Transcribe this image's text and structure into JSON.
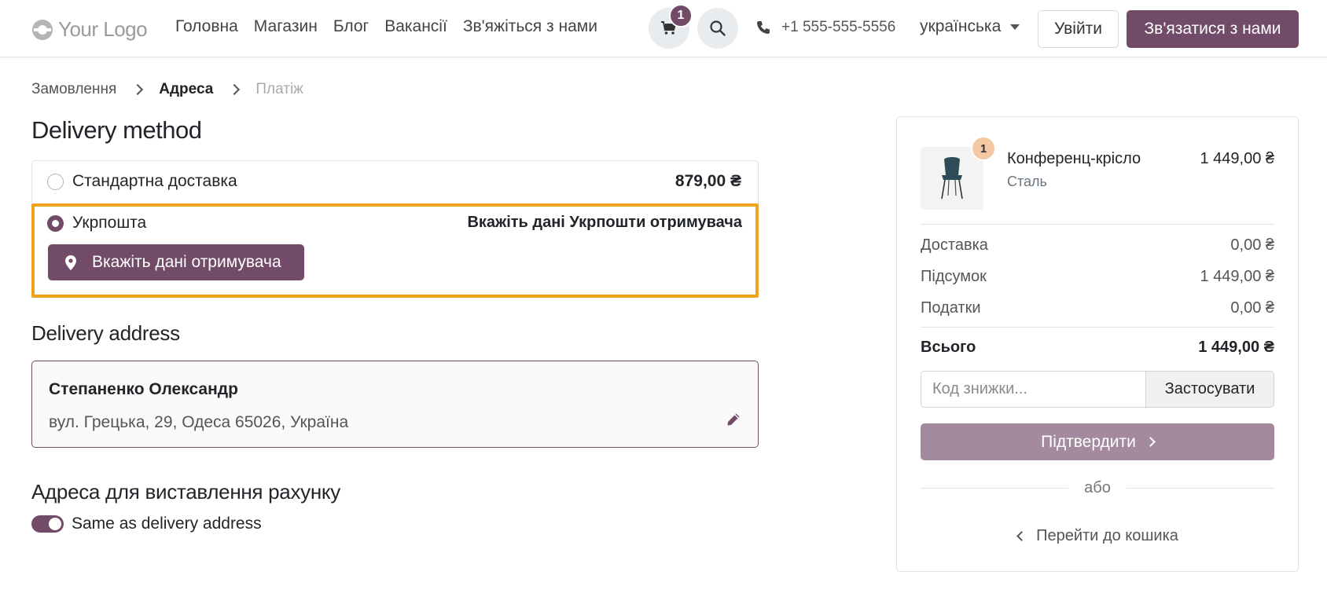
{
  "header": {
    "logo_text": "Your Logo",
    "nav": [
      "Головна",
      "Магазин",
      "Блог",
      "Вакансії",
      "Зв'яжіться з нами"
    ],
    "cart_count": "1",
    "phone": "+1 555-555-5556",
    "language": "українська",
    "login_label": "Увійти",
    "contact_label": "Зв'язатися з нами"
  },
  "breadcrumb": [
    "Замовлення",
    "Адреса",
    "Платіж"
  ],
  "delivery": {
    "title": "Delivery method",
    "methods": [
      {
        "label": "Стандартна доставка",
        "price": "879,00 ₴",
        "selected": false
      },
      {
        "label": "Укрпошта",
        "price": "Вкажіть дані Укрпошти отримувача",
        "selected": true
      }
    ],
    "recipient_button": "Вкажіть дані отримувача"
  },
  "address": {
    "title": "Delivery address",
    "name": "Степаненко Олександр",
    "line": "вул. Грецька, 29, Одеса 65026, Україна"
  },
  "billing": {
    "title": "Адреса для виставлення рахунку",
    "same_label": "Same as delivery address",
    "same_enabled": true
  },
  "summary": {
    "product": {
      "qty": "1",
      "name": "Конференц-крісло",
      "variant": "Сталь",
      "price": "1 449,00 ₴"
    },
    "rows": [
      {
        "label": "Доставка",
        "value": "0,00 ₴"
      },
      {
        "label": "Підсумок",
        "value": "1 449,00 ₴"
      },
      {
        "label": "Податки",
        "value": "0,00 ₴"
      }
    ],
    "total_label": "Всього",
    "total_value": "1 449,00 ₴",
    "promo_placeholder": "Код знижки...",
    "promo_button": "Застосувати",
    "confirm_label": "Підтвердити",
    "or_label": "або",
    "back_label": "Перейти до кошика"
  },
  "colors": {
    "primary": "#714b67",
    "highlight": "#f0a21a",
    "confirm_disabled": "#a48a9e"
  }
}
